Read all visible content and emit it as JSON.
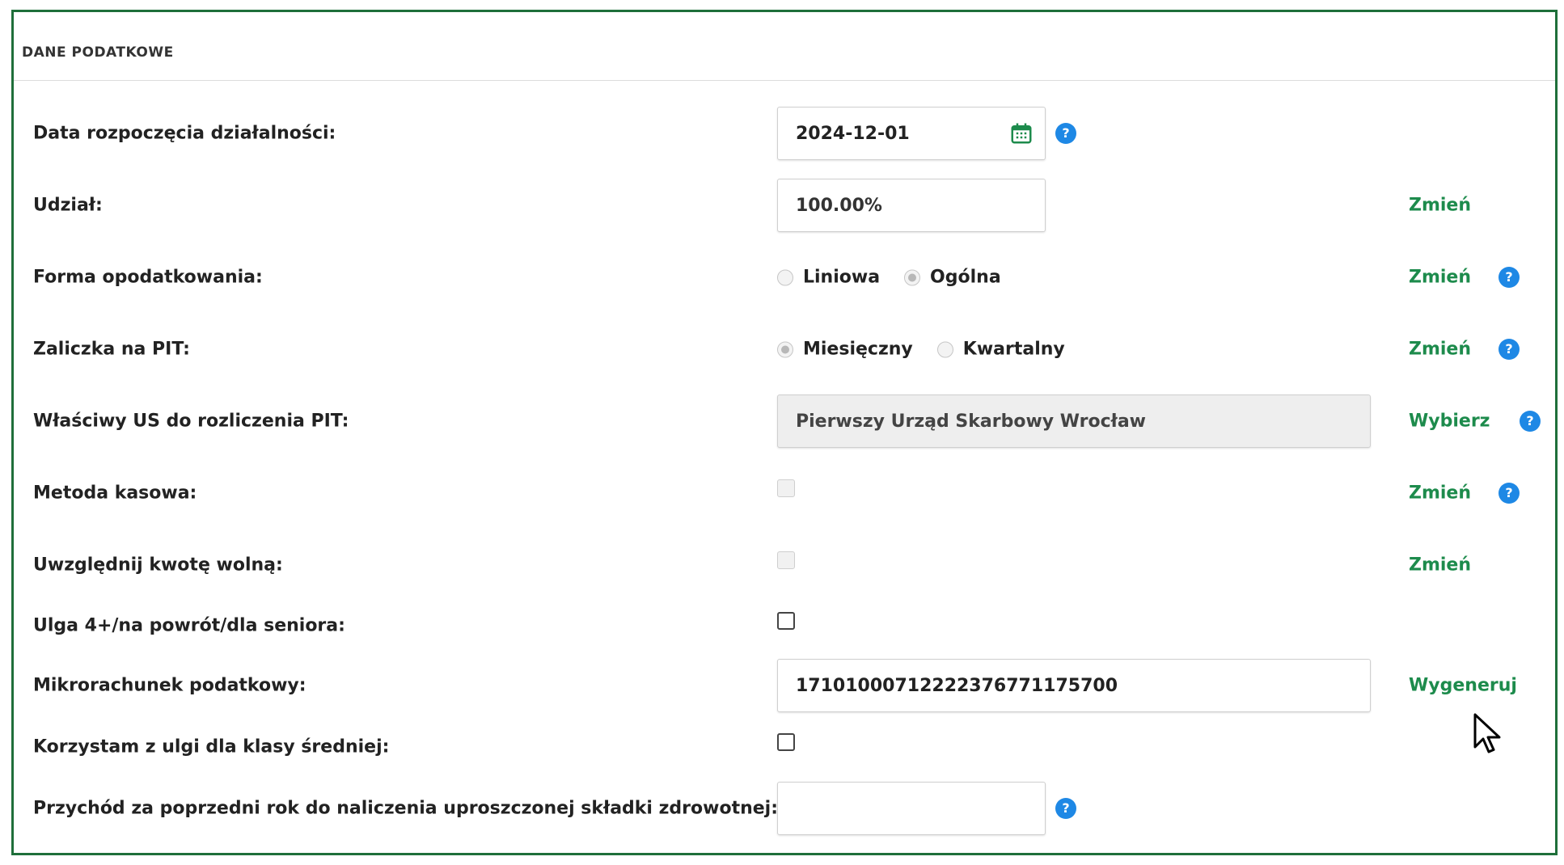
{
  "section": {
    "title": "DANE PODATKOWE"
  },
  "fields": {
    "start_date": {
      "label": "Data rozpoczęcia działalności:",
      "value": "2024-12-01"
    },
    "share": {
      "label": "Udział:",
      "value": "100.00%",
      "action": "Zmień"
    },
    "tax_form": {
      "label": "Forma opodatkowania:",
      "options": [
        "Liniowa",
        "Ogólna"
      ],
      "selected": "Ogólna",
      "action": "Zmień"
    },
    "pit_advance": {
      "label": "Zaliczka na PIT:",
      "options": [
        "Miesięczny",
        "Kwartalny"
      ],
      "selected": "Miesięczny",
      "action": "Zmień"
    },
    "tax_office": {
      "label": "Właściwy US do rozliczenia PIT:",
      "value": "Pierwszy Urząd Skarbowy Wrocław",
      "action": "Wybierz"
    },
    "cash_method": {
      "label": "Metoda kasowa:",
      "checked": false,
      "action": "Zmień"
    },
    "tax_free": {
      "label": "Uwzględnij kwotę wolną:",
      "checked": false,
      "action": "Zmień"
    },
    "relief": {
      "label": "Ulga 4+/na powrót/dla seniora:",
      "checked": false
    },
    "micro_account": {
      "label": "Mikrorachunek podatkowy:",
      "value": "17101000712222376771175700",
      "action": "Wygeneruj"
    },
    "middle_class": {
      "label": "Korzystam z ulgi dla klasy średniej:",
      "checked": false
    },
    "prev_year_income": {
      "label": "Przychód za poprzedni rok do naliczenia uproszczonej składki zdrowotnej:",
      "value": ""
    }
  },
  "help_symbol": "?",
  "colors": {
    "accent": "#1d8b4c",
    "help": "#1e88e5",
    "border": "#1f6f3a"
  },
  "icons": {
    "calendar": "calendar-icon",
    "help": "help-icon",
    "cursor": "mouse-cursor-icon"
  }
}
